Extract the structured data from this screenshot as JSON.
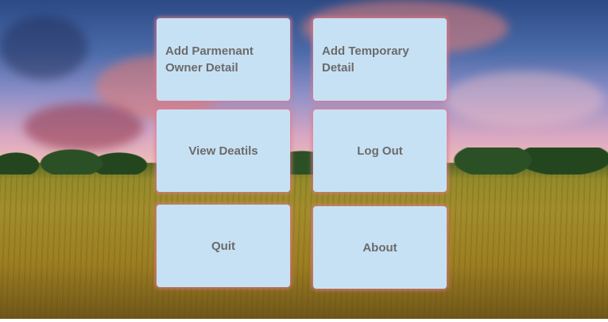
{
  "menu": {
    "add_permanent_owner_label": "Add Parmenant Owner Detail",
    "add_temporary_label": "Add Temporary Detail",
    "view_details_label": "View Deatils",
    "log_out_label": "Log Out",
    "quit_label": "Quit",
    "about_label": "About"
  },
  "colors": {
    "tile_background": "#c7e1f4",
    "tile_glow": "#e1788c",
    "tile_text": "#6b6b6b"
  }
}
